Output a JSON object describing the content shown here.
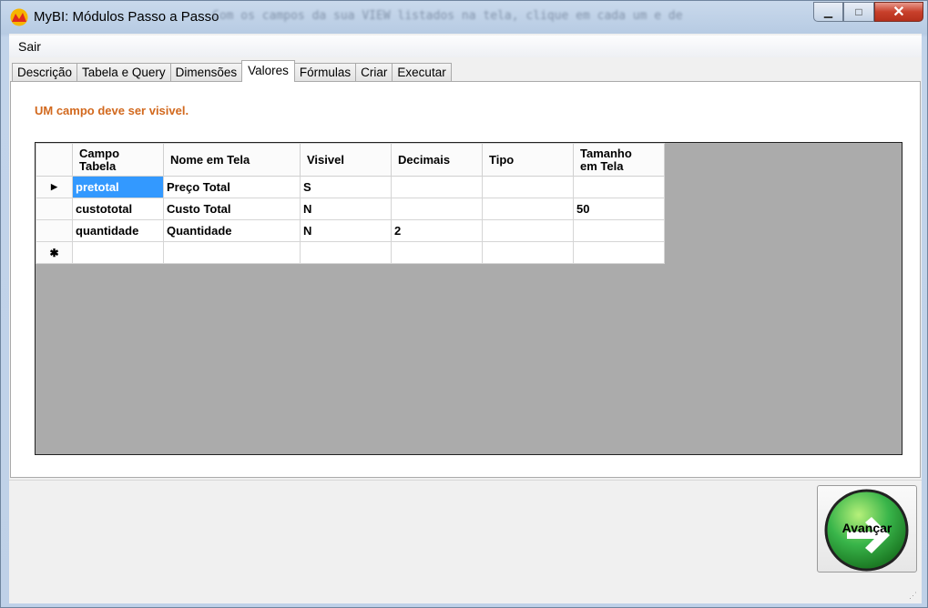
{
  "window": {
    "title": "MyBI: Módulos Passo a Passo",
    "background_text": "Com os campos da sua VIEW listados na tela, clique em cada um e de",
    "minimize_glyph": "▁",
    "maximize_glyph": "□",
    "close_glyph": "✕"
  },
  "menu": {
    "items": [
      "Sair"
    ]
  },
  "tabs": [
    {
      "label": "Descrição"
    },
    {
      "label": "Tabela e Query"
    },
    {
      "label": "Dimensões"
    },
    {
      "label": "Valores",
      "active": true
    },
    {
      "label": "Fórmulas"
    },
    {
      "label": "Criar"
    },
    {
      "label": "Executar"
    }
  ],
  "panel": {
    "hint": "UM campo deve ser visivel.",
    "hint_color": "#d2691e"
  },
  "grid": {
    "columns": [
      "Campo Tabela",
      "Nome em Tela",
      "Visivel",
      "Decimais",
      "Tipo",
      "Tamanho em Tela"
    ],
    "rows": [
      [
        "pretotal",
        "Preço Total",
        "S",
        "",
        "",
        ""
      ],
      [
        "custototal",
        "Custo Total",
        "N",
        "",
        "",
        "50"
      ],
      [
        "quantidade",
        "Quantidade",
        "N",
        "2",
        "",
        ""
      ]
    ],
    "current_row_marker": "▶",
    "new_row_marker": "✱",
    "selected_cell_color": "#3399ff"
  },
  "next_button": {
    "label": "Avançar",
    "color": "#39b54a"
  }
}
